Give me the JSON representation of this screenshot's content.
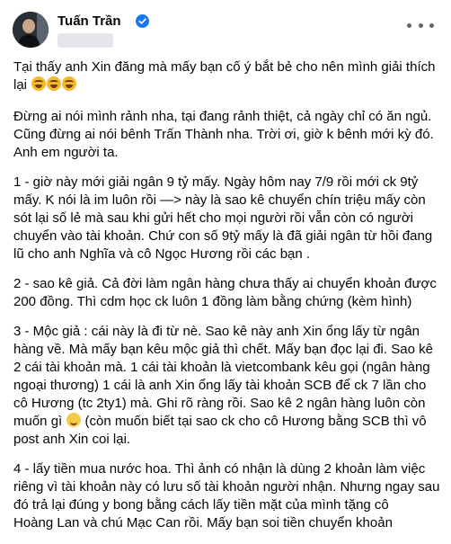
{
  "post": {
    "author_name": "Tuấn Trần",
    "paragraphs": [
      {
        "lines": [
          "Tại thấy anh Xin đăng mà mấy bạn cố ý bắt bẻ cho nên mình giải thích",
          "lại"
        ],
        "trailing_emoji": [
          "laughing-tears-emoji",
          "laughing-tears-emoji",
          "laughing-tears-emoji"
        ]
      },
      {
        "lines": [
          "Đừng ai nói mình rảnh nha, tại đang rảnh thiệt, cả ngày chỉ có ăn ngủ.",
          "Cũng đừng ai nói bênh Trấn Thành nha. Trời ơi, giờ k bênh mới kỳ đó.",
          "Anh em người ta."
        ]
      },
      {
        "lines": [
          "1 - giờ này mới giải ngân 9 tỷ mấy. Ngày hôm nay 7/9 rồi mới ck 9tỷ",
          "mấy. K nói là im luôn rồi —> này là sao kê chuyển chín triệu mấy còn",
          "sót lại số lẻ mà sau khi gửi hết cho mọi người rồi vẫn còn có người",
          "chuyển vào tài khoản. Chứ con số 9tỷ mấy là đã giải ngân từ hồi đang",
          "lũ cho anh Nghĩa và cô Ngọc Hương rồi các bạn ."
        ]
      },
      {
        "lines": [
          "2 -  sao kê giả. Cả đời làm ngân hàng chưa thấy ai chuyển khoản được",
          "200 đồng. Thì cdm học ck luôn 1 đồng làm bằng chứng (kèm hình)"
        ]
      },
      {
        "lines": [
          "3 - Mộc giả : cái này là đi từ nè. Sao kê này anh Xin ổng lấy từ ngân",
          "hàng về. Mà mấy bạn kêu mộc giả thì chết. Mấy bạn đọc lại đi. Sao kê",
          "2 cái tài khoản mà. 1 cái tài khoản là vietcombank kêu gọi (ngân hàng",
          "ngoại thương) 1 cái là anh Xin ổng lấy tài khoản SCB để ck 7 lần cho",
          "cô Hương (tc 2ty1) mà. Ghi rõ ràng rồi. Sao kê 2 ngân hàng luôn còn"
        ],
        "emoji_line_prefix": "muốn gì",
        "emoji_line_suffix": "(còn muốn biết tại sao ck cho cô Hương bằng SCB thì vô",
        "tail_lines": [
          "post anh Xin coi lại."
        ]
      },
      {
        "lines": [
          "4 - lấy tiền mua nước hoa. Thì ảnh có nhận là dùng 2 khoản làm việc",
          "riêng vì tài khoản này có lưu số tài khoản người nhận. Nhưng ngay sau",
          "đó trả lại đúng y bong bằng cách lấy tiền mặt của mình tặng cô",
          "Hoàng Lan và chú Mạc Can rồi. Mấy bạn soi tiền chuyển khoản"
        ]
      }
    ]
  },
  "icons": {
    "verified": "verified-badge-icon",
    "more": "more-options-icon",
    "smile": "smiling-face-emoji"
  },
  "colors": {
    "verified_blue": "#1877f2",
    "text": "#050505",
    "muted": "#65676b"
  }
}
